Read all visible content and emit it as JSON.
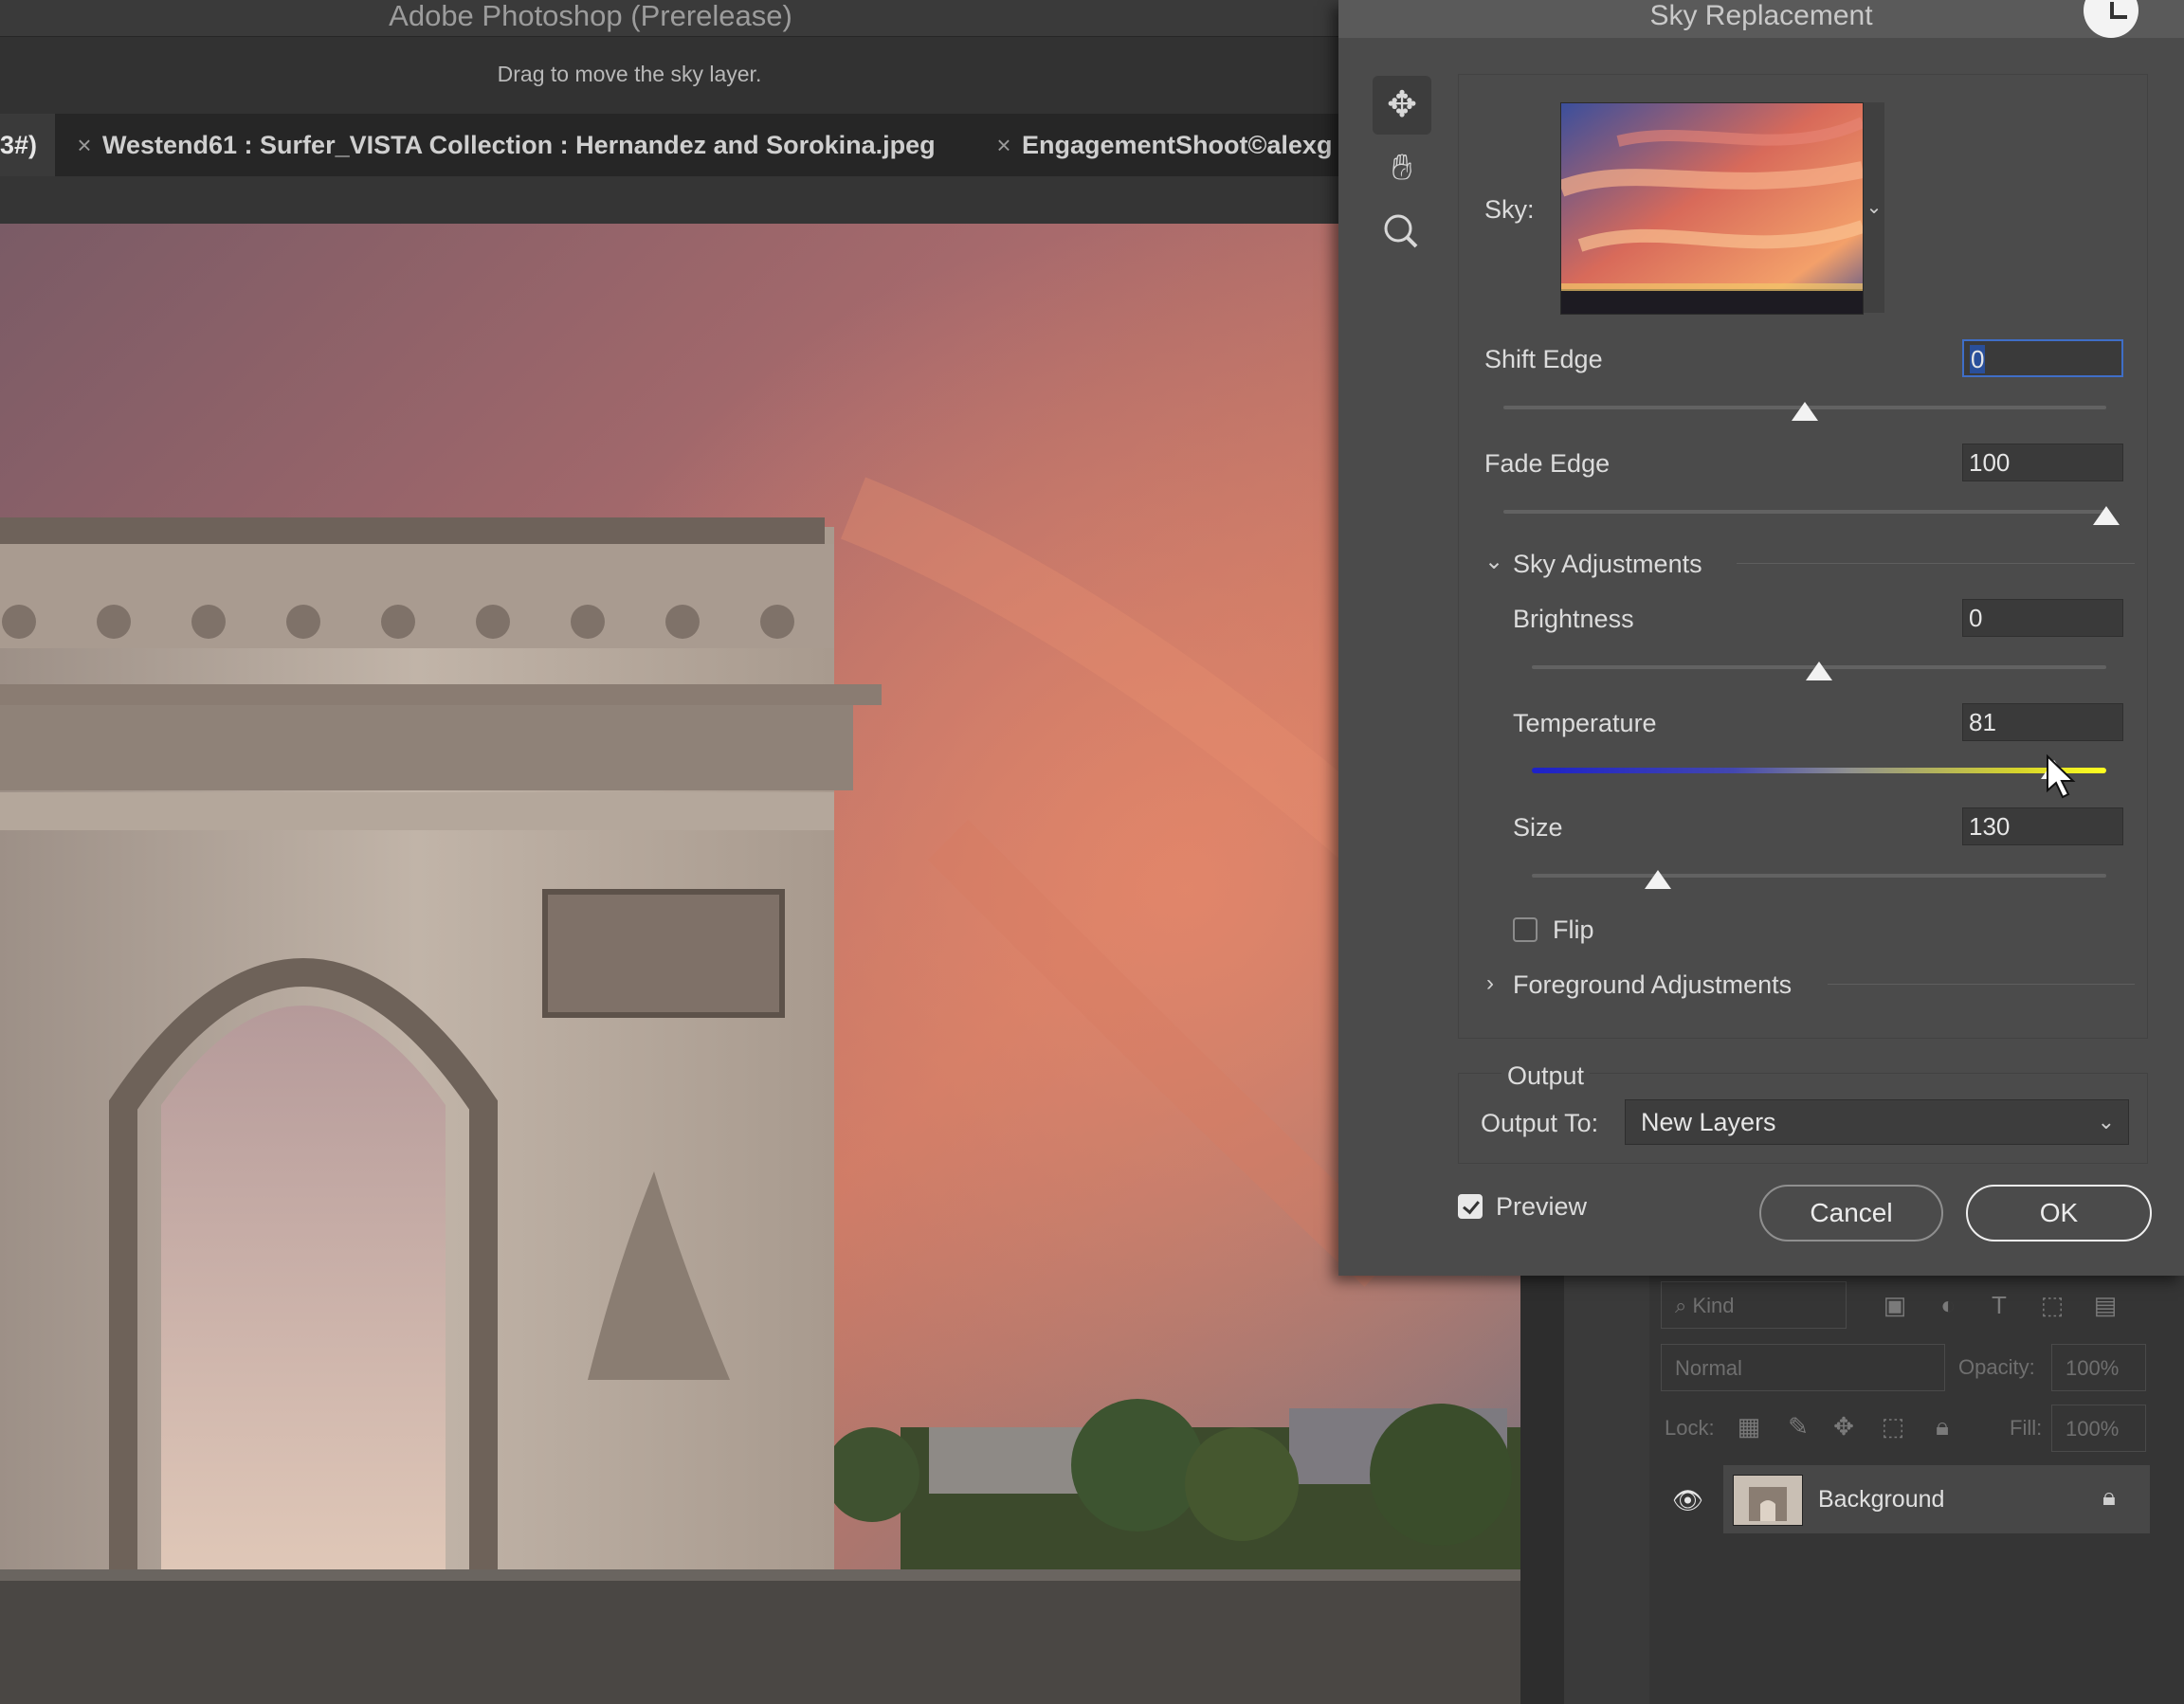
{
  "app": {
    "title": "Adobe Photoshop (Prerelease)",
    "hint": "Drag to move the sky layer."
  },
  "tabs": [
    {
      "label": "3#)"
    },
    {
      "label": "Westend61 : Surfer_VISTA Collection : Hernandez and Sorokina.jpeg"
    },
    {
      "label": "EngagementShoot©alexg"
    }
  ],
  "dialog": {
    "title": "Sky Replacement",
    "sky_label": "Sky:",
    "shift_edge": {
      "label": "Shift Edge",
      "value": "0",
      "fraction": 0.5
    },
    "fade_edge": {
      "label": "Fade Edge",
      "value": "100",
      "fraction": 1.0
    },
    "sky_adjustments": {
      "label": "Sky Adjustments",
      "brightness": {
        "label": "Brightness",
        "value": "0",
        "fraction": 0.5
      },
      "temperature": {
        "label": "Temperature",
        "value": "81",
        "fraction": 0.91
      },
      "size": {
        "label": "Size",
        "value": "130",
        "fraction": 0.22
      },
      "flip": {
        "label": "Flip",
        "checked": false
      }
    },
    "foreground_adjustments": {
      "label": "Foreground Adjustments"
    },
    "output": {
      "section_label": "Output",
      "output_to_label": "Output To:",
      "output_to_value": "New Layers"
    },
    "preview": {
      "label": "Preview",
      "checked": true
    },
    "cancel_label": "Cancel",
    "ok_label": "OK"
  },
  "layers_panel": {
    "kind_placeholder": "Kind",
    "blend_mode": "Normal",
    "opacity_label": "Opacity:",
    "opacity_value": "100%",
    "lock_label": "Lock:",
    "fill_label": "Fill:",
    "fill_value": "100%",
    "layer_name": "Background"
  },
  "icons": [
    "move-icon",
    "hand-icon",
    "zoom-icon",
    "close-icon",
    "chevron-down-icon",
    "chevron-right-icon",
    "eye-icon",
    "lock-icon",
    "search-icon"
  ]
}
